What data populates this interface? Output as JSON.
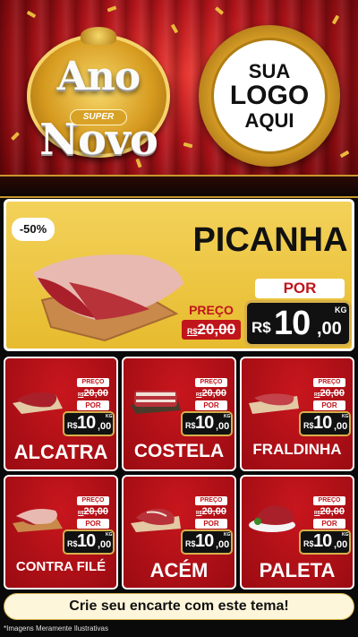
{
  "badge": {
    "ano": "Ano",
    "super": "SUPER",
    "novo": "Novo"
  },
  "logo": {
    "line1": "SUA",
    "line2": "LOGO",
    "line3": "AQUI"
  },
  "featured": {
    "discount": "-50%",
    "name": "PICANHA",
    "preco_label": "PREÇO",
    "old_currency": "R$",
    "old_price": "20,00",
    "por_label": "POR",
    "currency": "R$",
    "price_int": "10",
    "price_dec": ",00",
    "unit": "KG"
  },
  "products": [
    {
      "name": "ALCATRA",
      "preco_label": "PREÇO",
      "old_currency": "R$",
      "old_price": "20,00",
      "por_label": "POR",
      "currency": "R$",
      "price_int": "10",
      "price_dec": ",00",
      "unit": "KG"
    },
    {
      "name": "COSTELA",
      "preco_label": "PREÇO",
      "old_currency": "R$",
      "old_price": "20,00",
      "por_label": "POR",
      "currency": "R$",
      "price_int": "10",
      "price_dec": ",00",
      "unit": "KG"
    },
    {
      "name": "FRALDINHA",
      "preco_label": "PREÇO",
      "old_currency": "R$",
      "old_price": "20,00",
      "por_label": "POR",
      "currency": "R$",
      "price_int": "10",
      "price_dec": ",00",
      "unit": "KG"
    },
    {
      "name": "CONTRA FILÉ",
      "preco_label": "PREÇO",
      "old_currency": "R$",
      "old_price": "20,00",
      "por_label": "POR",
      "currency": "R$",
      "price_int": "10",
      "price_dec": ",00",
      "unit": "KG"
    },
    {
      "name": "ACÉM",
      "preco_label": "PREÇO",
      "old_currency": "R$",
      "old_price": "20,00",
      "por_label": "POR",
      "currency": "R$",
      "price_int": "10",
      "price_dec": ",00",
      "unit": "KG"
    },
    {
      "name": "PALETA",
      "preco_label": "PREÇO",
      "old_currency": "R$",
      "old_price": "20,00",
      "por_label": "POR",
      "currency": "R$",
      "price_int": "10",
      "price_dec": ",00",
      "unit": "KG"
    }
  ],
  "cta": "Crie seu encarte com este tema!",
  "disclaimer": "*Imagens Meramente Ilustrativas",
  "colors": {
    "red": "#c0151b",
    "gold": "#d6b04a",
    "yellow": "#f3d25a",
    "dark": "#111111"
  }
}
